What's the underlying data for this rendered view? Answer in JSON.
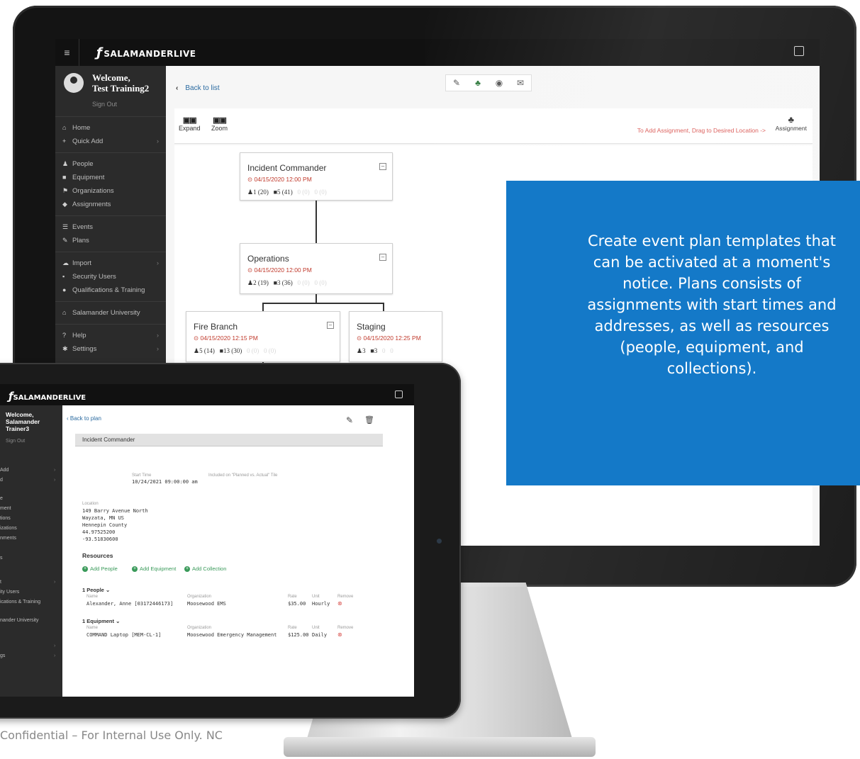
{
  "monitor": {
    "app_logo": "SALAMANDERLIVE",
    "sidebar": {
      "welcome_line1": "Welcome,",
      "welcome_line2": "Test Training2",
      "sign_out": "Sign Out",
      "items": [
        {
          "icon": "home-icon",
          "label": "Home"
        },
        {
          "icon": "plus-icon",
          "label": "Quick Add"
        },
        {
          "icon": "person-icon",
          "label": "People"
        },
        {
          "icon": "truck-icon",
          "label": "Equipment"
        },
        {
          "icon": "flag-icon",
          "label": "Organizations"
        },
        {
          "icon": "tag-icon",
          "label": "Assignments"
        },
        {
          "icon": "list-icon",
          "label": "Events"
        },
        {
          "icon": "edit-icon",
          "label": "Plans"
        },
        {
          "icon": "cloud-icon",
          "label": "Import"
        },
        {
          "icon": "lock-icon",
          "label": "Security Users"
        },
        {
          "icon": "cert-icon",
          "label": "Qualifications & Training"
        },
        {
          "icon": "university-icon",
          "label": "Salamander University"
        },
        {
          "icon": "help-icon",
          "label": "Help"
        },
        {
          "icon": "gear-icon",
          "label": "Settings"
        }
      ]
    },
    "back_to_list": "Back to list",
    "toolbar": {
      "expand": "Expand",
      "zoom": "Zoom",
      "hint": "To Add Assignment, Drag to Desired Location ->",
      "assignment": "Assignment"
    },
    "nodes": [
      {
        "title": "Incident Commander",
        "datetime": "04/15/2020 12:00 PM",
        "people": "1 (20)",
        "equipment": "5 (41)",
        "faded1": "0 (0)",
        "faded2": "0 (0)"
      },
      {
        "title": "Operations",
        "datetime": "04/15/2020 12:00 PM",
        "people": "2 (19)",
        "equipment": "3 (36)",
        "faded1": "0 (0)",
        "faded2": "0 (0)"
      },
      {
        "title": "Fire Branch",
        "datetime": "04/15/2020 12:15 PM",
        "people": "5 (14)",
        "equipment": "13 (30)",
        "faded1": "0 (0)",
        "faded2": "0 (0)"
      },
      {
        "title": "Staging",
        "datetime": "04/15/2020 12:25 PM",
        "people": "3",
        "equipment": "3",
        "faded1": "0",
        "faded2": "0"
      }
    ]
  },
  "callout": "Create event plan templates that\ncan be activated at a moment's\nnotice. Plans consists of\nassignments with start times and\naddresses, as well as resources\n(people, equipment, and\ncollections).",
  "tablet": {
    "app_logo": "SALAMANDERLIVE",
    "sidebar": {
      "welcome": "Welcome,",
      "name1": "Salamander",
      "name2": "Trainer3",
      "sign_out": "Sign Out",
      "items": [
        "Add",
        "d",
        "e",
        "ment",
        "tions",
        "izations",
        "nments",
        "s",
        "t",
        "ity Users",
        "ications & Training",
        "nander University",
        "gs"
      ]
    },
    "back_to_plan": "Back to plan",
    "header": "Incident Commander",
    "start_time_label": "Start Time",
    "start_time": "10/24/2021 09:00:00 am",
    "included_label": "Included on \"Planned vs. Actual\" Tile",
    "location_label": "Location",
    "address": [
      "149 Barry Avenue North",
      "Wayzata, MN US",
      "Hennepin County",
      "44.97525200",
      "-93.51830600"
    ],
    "resources_title": "Resources",
    "add_people": "Add People",
    "add_equipment": "Add Equipment",
    "add_collection": "Add Collection",
    "people_section": "1 People",
    "equipment_section": "1 Equipment",
    "cols": {
      "name": "Name",
      "organization": "Organization",
      "rate": "Rate",
      "unit": "Unit",
      "remove": "Remove"
    },
    "people_row": {
      "name": "Alexander, Anne [03172446173]",
      "organization": "Moosewood EMS",
      "rate": "$35.00",
      "unit": "Hourly"
    },
    "equipment_row": {
      "name": "COMMAND Laptop [MEM-CL-1]",
      "organization": "Moosewood Emergency Management",
      "rate": "$125.00",
      "unit": "Daily"
    }
  },
  "footer": "Confidential – For Internal Use Only.  NC",
  "colors": {
    "callout": "#1479c8",
    "date_red": "#c0392b",
    "hint_red": "#d9534f",
    "link_blue": "#2a6aa0",
    "add_green": "#3a9a5a"
  }
}
